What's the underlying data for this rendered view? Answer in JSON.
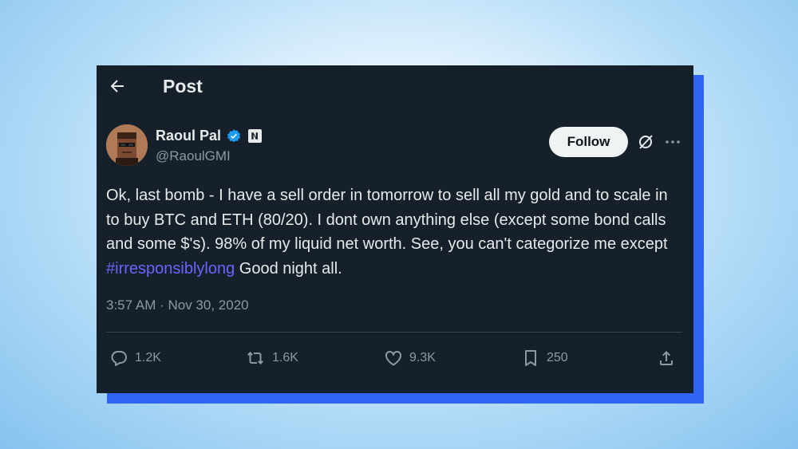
{
  "header": {
    "title": "Post",
    "back_icon": "arrow-left-icon"
  },
  "author": {
    "display_name": "Raoul Pal",
    "handle": "@RaoulGMI",
    "verified": true,
    "avatar": "pixel-art-avatar"
  },
  "follow_label": "Follow",
  "tweet": {
    "text_before": "Ok, last bomb - I have a sell order in tomorrow to sell all my gold and to scale in to buy BTC and ETH (80/20). I dont own anything else (except some bond calls and some $'s). 98% of my liquid net worth. See, you can't categorize me except ",
    "hashtag": "#irresponsiblylong",
    "text_after": " Good night all.",
    "timestamp": "3:57 AM · Nov 30, 2020"
  },
  "actions": {
    "replies": "1.2K",
    "reposts": "1.6K",
    "likes": "9.3K",
    "bookmarks": "250"
  },
  "colors": {
    "card_bg": "#15202b",
    "accent_shadow": "#2f65f2",
    "hashtag": "#6d63ff",
    "verified": "#1d9bf0"
  }
}
